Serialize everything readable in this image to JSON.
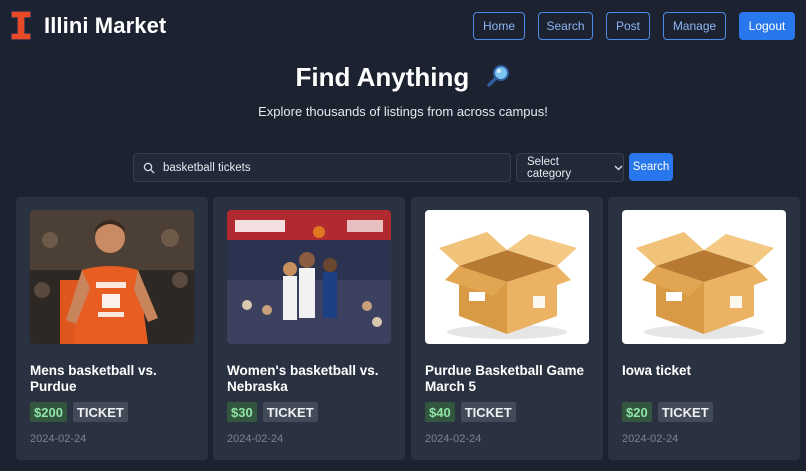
{
  "brand": {
    "name": "Illini Market",
    "logo_icon": "block-i-logo-icon"
  },
  "nav": {
    "home": "Home",
    "search": "Search",
    "post": "Post",
    "manage": "Manage",
    "logout": "Logout"
  },
  "hero": {
    "title": "Find Anything",
    "title_icon": "magnifying-glass-emoji-icon",
    "subtitle": "Explore thousands of listings from across campus!"
  },
  "search": {
    "value": "basketball tickets",
    "icon": "search-icon",
    "category_label": "Select category",
    "button": "Search"
  },
  "listings": [
    {
      "title": "Mens basketball vs. Purdue",
      "price": "$200",
      "type": "TICKET",
      "date": "2024-02-24",
      "image": "photo-mens-basketball-player"
    },
    {
      "title": "Women's basketball vs. Nebraska",
      "price": "$30",
      "type": "TICKET",
      "date": "2024-02-24",
      "image": "photo-womens-basketball-game"
    },
    {
      "title": "Purdue Basketball Game March 5",
      "price": "$40",
      "type": "TICKET",
      "date": "2024-02-24",
      "image": "open-cardboard-box"
    },
    {
      "title": "Iowa ticket",
      "price": "$20",
      "type": "TICKET",
      "date": "2024-02-24",
      "image": "open-cardboard-box"
    }
  ],
  "colors": {
    "background": "#1c2230",
    "card": "#2a3140",
    "accent": "#2877ec",
    "brand_orange": "#e84a27",
    "price_green": "#8fe3a5"
  }
}
